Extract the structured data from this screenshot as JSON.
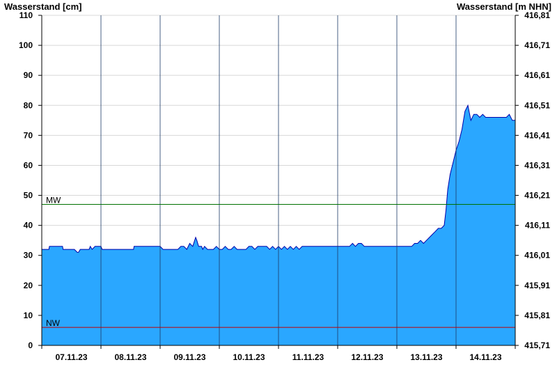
{
  "chart_data": {
    "type": "area",
    "ylabel_left": "Wasserstand [cm]",
    "ylabel_right": "Wasserstand [m NHN]",
    "ylim": [
      0,
      110
    ],
    "yticks_left": [
      0,
      10,
      20,
      30,
      40,
      50,
      60,
      70,
      80,
      90,
      100,
      110
    ],
    "yticks_right": [
      "415,71",
      "415,81",
      "415,91",
      "416,01",
      "416,11",
      "416,21",
      "416,31",
      "416,41",
      "416,51",
      "416,61",
      "416,71",
      "416,81"
    ],
    "xlim_days": [
      0,
      8
    ],
    "x_labels": [
      "07.11.23",
      "08.11.23",
      "09.11.23",
      "10.11.23",
      "11.11.23",
      "12.11.23",
      "13.11.23",
      "14.11.23"
    ],
    "grid": true,
    "colors": {
      "fill": "#2aa7ff",
      "line": "#0000aa",
      "mw_line": "#007000",
      "nw_line": "#c00000",
      "grid": "#d8d8d8"
    },
    "reference_lines": [
      {
        "name": "MW",
        "value": 47
      },
      {
        "name": "NW",
        "value": 6
      }
    ],
    "series": [
      {
        "x": [
          0,
          0.12,
          0.13,
          0.35,
          0.36,
          0.55,
          0.6,
          0.62,
          0.65,
          0.8,
          0.82,
          0.85,
          0.9,
          1.0,
          1.02,
          1.2,
          1.5,
          1.55,
          1.56,
          1.8,
          1.9,
          2.0,
          2.05,
          2.2,
          2.3,
          2.35,
          2.4,
          2.45,
          2.5,
          2.55,
          2.6,
          2.62,
          2.65,
          2.7,
          2.72,
          2.75,
          2.8,
          2.9,
          2.95,
          3.0,
          3.05,
          3.1,
          3.15,
          3.2,
          3.25,
          3.3,
          3.35,
          3.4,
          3.45,
          3.5,
          3.55,
          3.6,
          3.65,
          3.7,
          3.75,
          3.8,
          3.85,
          3.9,
          3.95,
          4.0,
          4.05,
          4.1,
          4.15,
          4.2,
          4.25,
          4.3,
          4.35,
          4.4,
          4.45,
          4.5,
          4.55,
          4.6,
          4.7,
          4.8,
          4.9,
          5.0,
          5.1,
          5.2,
          5.25,
          5.3,
          5.35,
          5.4,
          5.45,
          5.5,
          5.6,
          5.7,
          5.8,
          5.9,
          6.0,
          6.1,
          6.2,
          6.25,
          6.3,
          6.35,
          6.4,
          6.45,
          6.5,
          6.55,
          6.6,
          6.65,
          6.7,
          6.75,
          6.8,
          6.83,
          6.86,
          6.9,
          6.95,
          7.0,
          7.05,
          7.1,
          7.15,
          7.2,
          7.25,
          7.3,
          7.35,
          7.4,
          7.45,
          7.5,
          7.55,
          7.6,
          7.65,
          7.7,
          7.75,
          7.8,
          7.85,
          7.9,
          7.95,
          8.0
        ],
        "values": [
          32,
          32,
          33,
          33,
          32,
          32,
          31,
          31,
          32,
          32,
          33,
          32,
          33,
          33,
          32,
          32,
          32,
          32,
          33,
          33,
          33,
          33,
          32,
          32,
          32,
          33,
          33,
          32,
          34,
          33,
          36,
          35,
          33,
          33,
          32,
          33,
          32,
          32,
          33,
          32,
          32,
          33,
          32,
          32,
          33,
          32,
          32,
          32,
          32,
          33,
          33,
          32,
          33,
          33,
          33,
          33,
          32,
          33,
          32,
          33,
          32,
          33,
          32,
          33,
          32,
          33,
          32,
          33,
          33,
          33,
          33,
          33,
          33,
          33,
          33,
          33,
          33,
          33,
          34,
          33,
          34,
          34,
          33,
          33,
          33,
          33,
          33,
          33,
          33,
          33,
          33,
          33,
          34,
          34,
          35,
          34,
          35,
          36,
          37,
          38,
          39,
          39,
          40,
          45,
          52,
          57,
          61,
          65,
          68,
          72,
          78,
          80,
          75,
          77,
          77,
          76,
          77,
          76,
          76,
          76,
          76,
          76,
          76,
          76,
          76,
          77,
          75,
          75
        ]
      }
    ]
  }
}
